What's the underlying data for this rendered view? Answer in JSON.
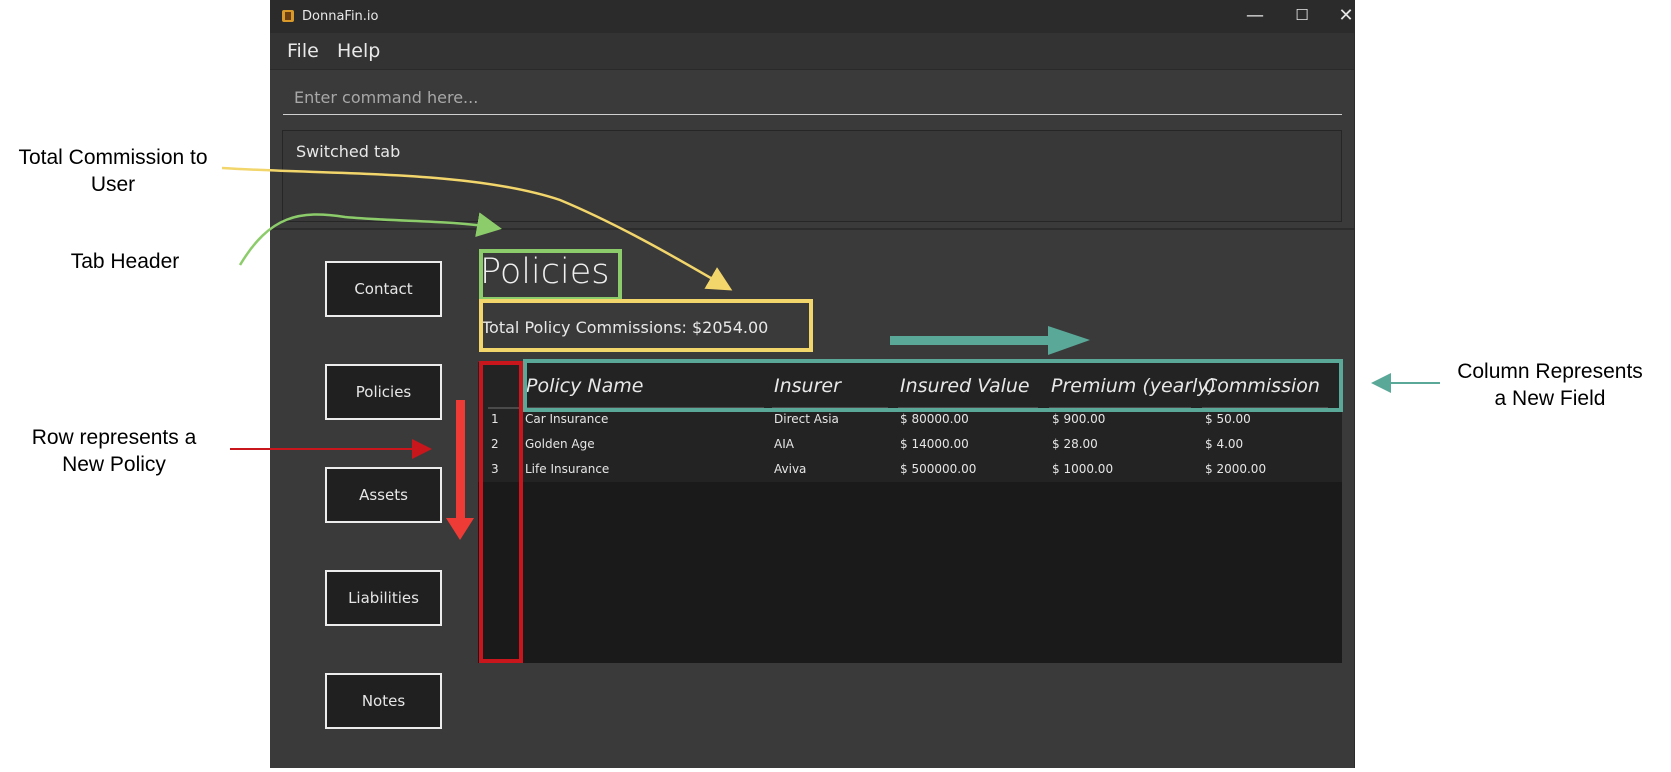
{
  "window": {
    "title": "DonnaFin.io",
    "controls": [
      "—",
      "☐",
      "✕"
    ]
  },
  "menu": {
    "file": "File",
    "help": "Help"
  },
  "command": {
    "placeholder": "Enter command here..."
  },
  "result": {
    "text": "Switched tab"
  },
  "nav": [
    "Contact",
    "Policies",
    "Assets",
    "Liabilities",
    "Notes"
  ],
  "tab": {
    "title": "Policies",
    "total_commission": "Total Policy Commissions: $2054.00"
  },
  "table": {
    "columns": [
      "Policy Name",
      "Insurer",
      "Insured Value",
      "Premium (yearly)",
      "Commission"
    ],
    "rows": [
      {
        "index": "1",
        "name": "Car Insurance",
        "insurer": "Direct Asia",
        "insured_value": "$ 80000.00",
        "premium": "$ 900.00",
        "commission": "$ 50.00"
      },
      {
        "index": "2",
        "name": "Golden Age",
        "insurer": "AIA",
        "insured_value": "$ 14000.00",
        "premium": "$ 28.00",
        "commission": "$ 4.00"
      },
      {
        "index": "3",
        "name": "Life Insurance",
        "insurer": "Aviva",
        "insured_value": "$ 500000.00",
        "premium": "$ 1000.00",
        "commission": "$ 2000.00"
      }
    ]
  },
  "annotations": {
    "total_commission": "Total Commission to\nUser",
    "tab_header": "Tab Header",
    "row": "Row represents a\nNew Policy",
    "column": "Column Represents\na New Field"
  },
  "colors": {
    "tab_header_box": "#8ccc6a",
    "commission_box": "#f2d56b",
    "row_box": "#c8161c",
    "column_box": "#5aa898",
    "row_arrow": "#ef3b36"
  }
}
